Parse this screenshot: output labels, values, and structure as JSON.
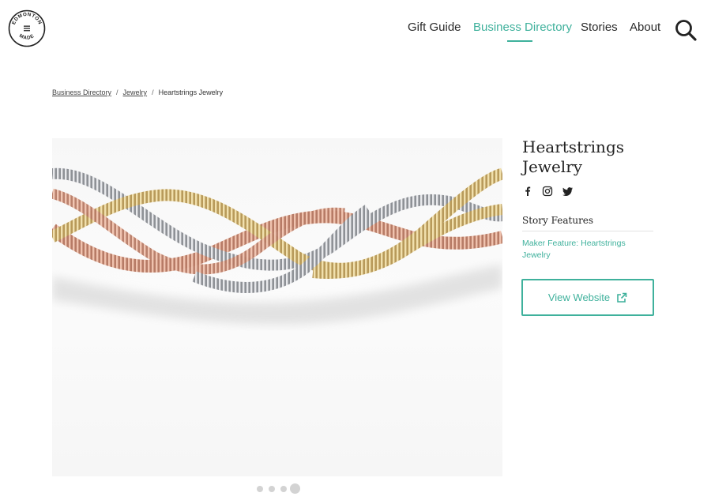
{
  "header": {
    "logo_text_top": "EDMONTON",
    "logo_text_bottom": "MADE",
    "nav": [
      {
        "label": "Gift Guide",
        "active": false
      },
      {
        "label": "Business Directory",
        "active": true
      },
      {
        "label": "Stories",
        "active": false
      },
      {
        "label": "About",
        "active": false
      }
    ],
    "search_icon": "search-icon",
    "accent_color": "#3fb19c"
  },
  "breadcrumb": {
    "items": [
      "Business Directory",
      "Jewelry"
    ],
    "current": "Heartstrings Jewelry",
    "separator": "/"
  },
  "hero": {
    "image": "braided-bracelet-photo",
    "slide_count": 4,
    "active_slide": 4
  },
  "business": {
    "title": "Heartstrings Jewelry",
    "social_icons": [
      "facebook-icon",
      "instagram-icon",
      "twitter-icon"
    ],
    "story_features_heading": "Story Features",
    "story_links": [
      "Maker Feature: Heartstrings Jewelry"
    ],
    "website_button": "View Website",
    "website_icon": "external-link-icon"
  }
}
